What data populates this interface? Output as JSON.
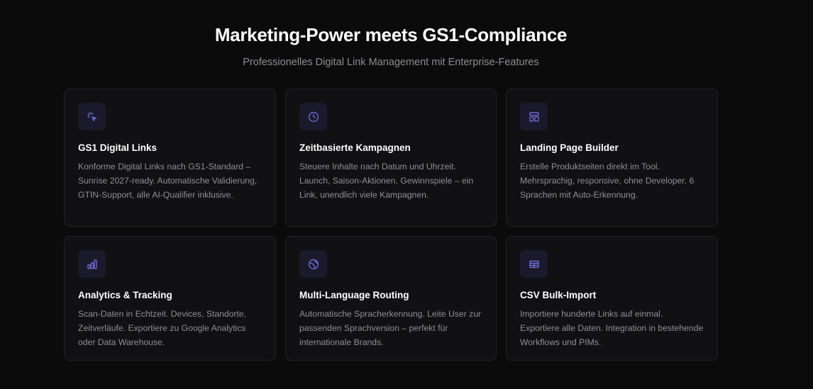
{
  "section": {
    "title": "Marketing-Power meets GS1-Compliance",
    "subtitle": "Professionelles Digital Link Management mit Enterprise-Features"
  },
  "features": [
    {
      "icon": "pointer-click-icon",
      "title": "GS1 Digital Links",
      "description": "Konforme Digital Links nach GS1-Standard – Sunrise 2027-ready. Automatische Validierung, GTIN-Support, alle AI-Qualifier inklusive."
    },
    {
      "icon": "clock-icon",
      "title": "Zeitbasierte Kampagnen",
      "description": "Steuere Inhalte nach Datum und Uhrzeit. Launch, Saison-Aktionen, Gewinnspiele – ein Link, unendlich viele Kampagnen."
    },
    {
      "icon": "layout-icon",
      "title": "Landing Page Builder",
      "description": "Erstelle Produktseiten direkt im Tool. Mehrsprachig, responsive, ohne Developer. 6 Sprachen mit Auto-Erkennung."
    },
    {
      "icon": "bar-chart-icon",
      "title": "Analytics & Tracking",
      "description": "Scan-Daten in Echtzeit. Devices, Standorte, Zeitverläufe. Exportiere zu Google Analytics oder Data Warehouse."
    },
    {
      "icon": "globe-icon",
      "title": "Multi-Language Routing",
      "description": "Automatische Spracherkennung. Leite User zur passenden Sprachversion – perfekt für internationale Brands."
    },
    {
      "icon": "table-icon",
      "title": "CSV Bulk-Import",
      "description": "Importiere hunderte Links auf einmal. Exportiere alle Daten. Integration in bestehende Workflows und PIMs."
    }
  ],
  "colors": {
    "background": "#0b0b0c",
    "card_background": "#111113",
    "card_border": "#232327",
    "icon_background": "#1b1a2c",
    "icon_accent": "#7c76e8",
    "text_muted": "#8e8e96"
  }
}
